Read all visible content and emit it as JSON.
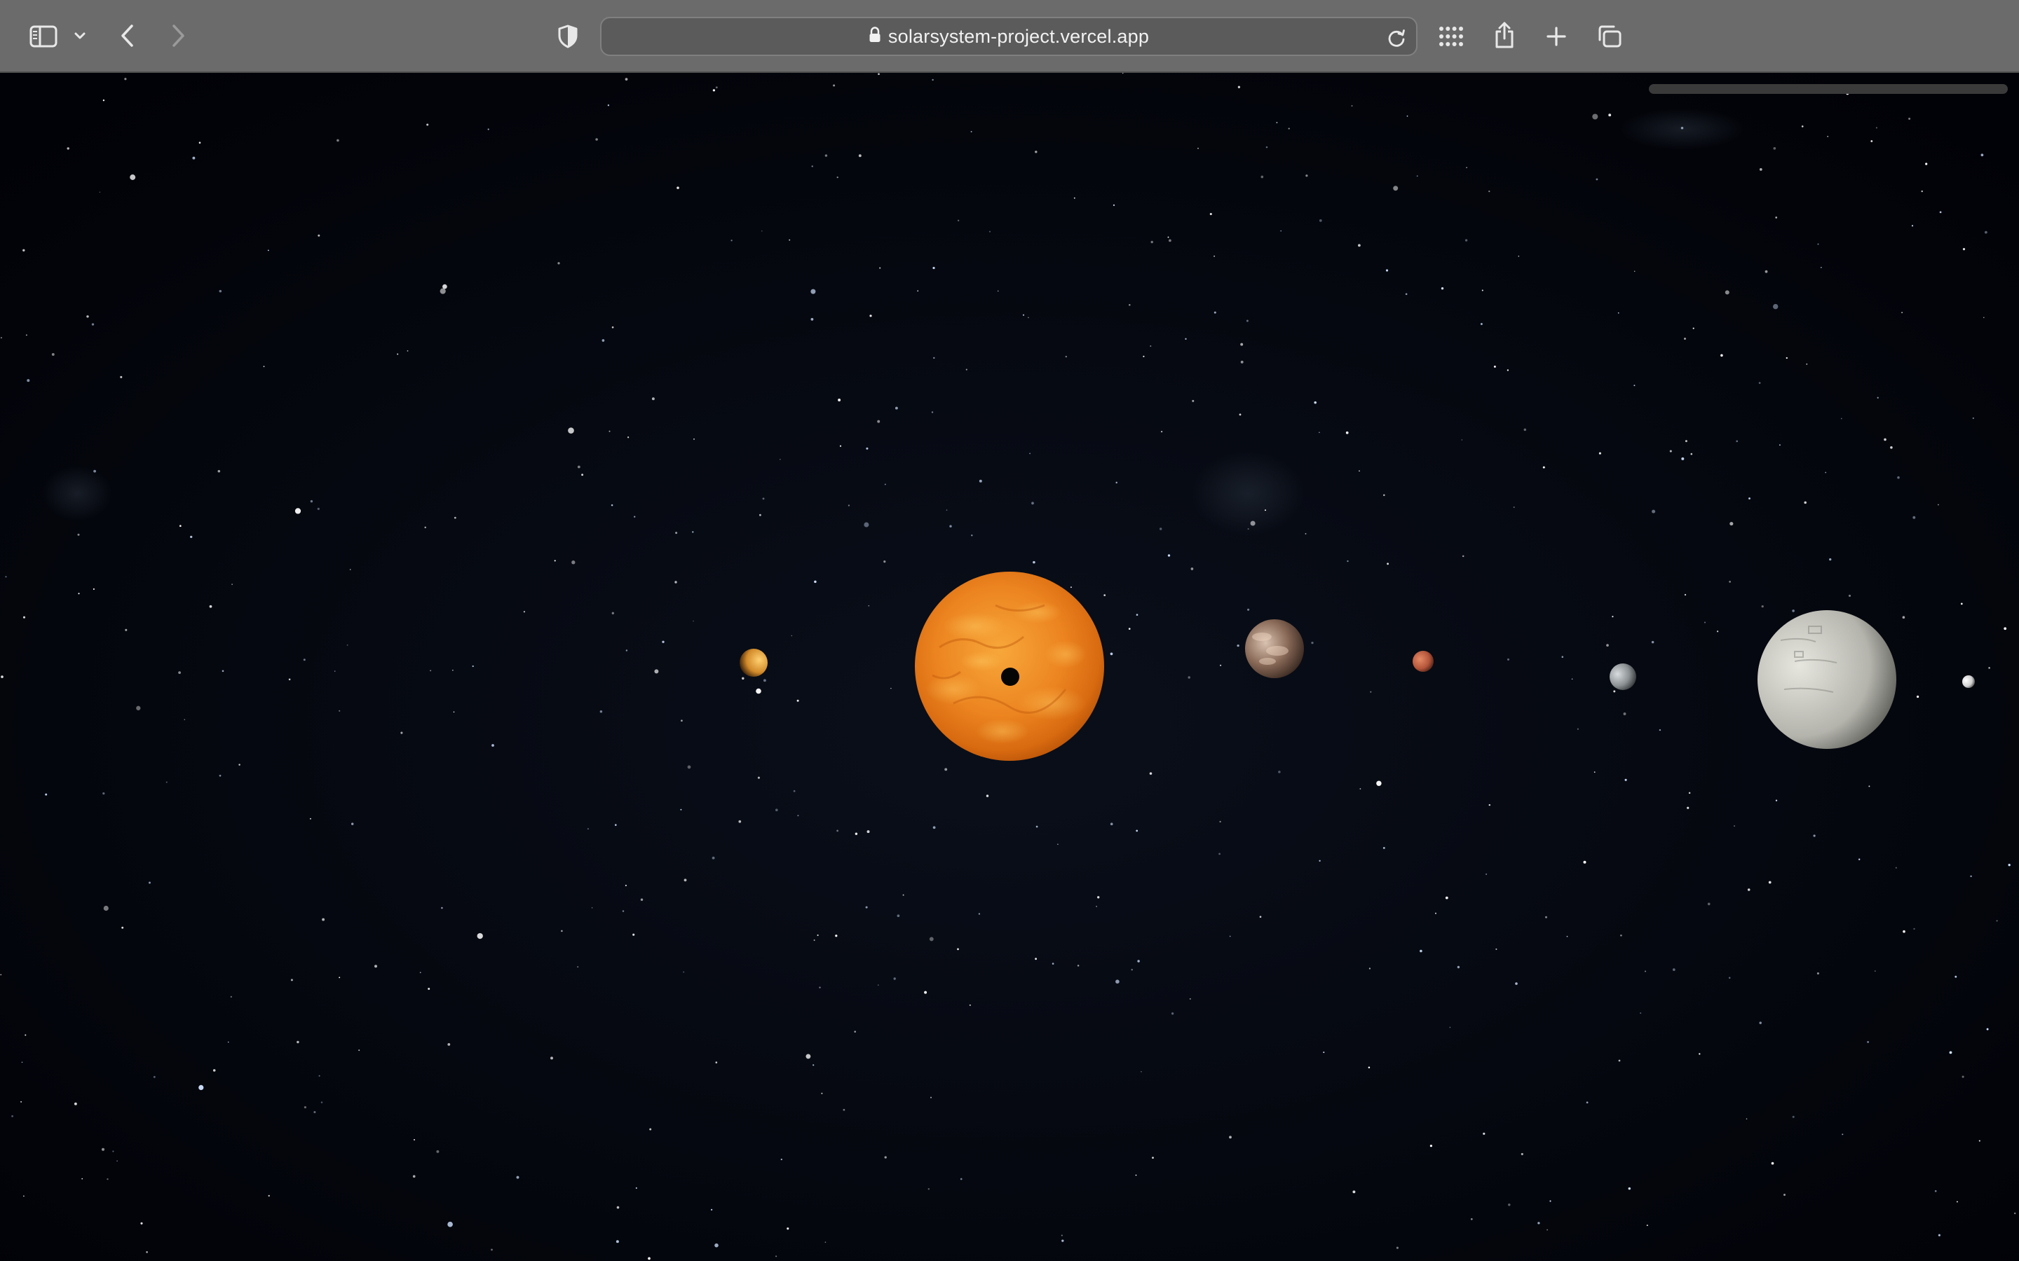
{
  "browser": {
    "address_bar": {
      "url": "solarsystem-project.vercel.app",
      "secure": true
    },
    "icons": {
      "sidebar": "sidebar-icon",
      "sidebar_menu": "chevron-down-icon",
      "back": "chevron-left-icon",
      "forward": "chevron-right-icon",
      "privacy": "shield-icon",
      "lock": "lock-icon",
      "reload": "reload-icon",
      "grid": "grid-icon",
      "share": "share-icon",
      "new_tab": "plus-icon",
      "tabs": "tabs-overview-icon"
    },
    "colors": {
      "toolbar": "#6b6b6b",
      "address_field": "#5b5b5b",
      "icon": "#e8e8e8",
      "icon_disabled": "#9a9a9a"
    }
  },
  "scene": {
    "background": "#02040a",
    "bodies": [
      {
        "name": "mercury",
        "color": "#e0a040"
      },
      {
        "name": "sun",
        "color": "#f08a20"
      },
      {
        "name": "venus",
        "color": "#b0907a"
      },
      {
        "name": "mars",
        "color": "#c8674a"
      },
      {
        "name": "earth",
        "color": "#9fa4a6"
      },
      {
        "name": "jupiter",
        "color": "#c9c9c2"
      },
      {
        "name": "saturn",
        "color": "#dadada"
      }
    ]
  }
}
